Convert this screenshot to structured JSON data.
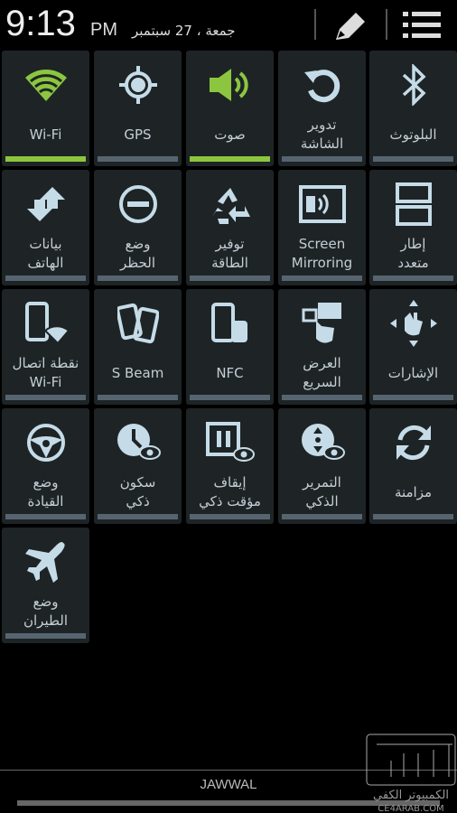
{
  "status": {
    "time": "9:13",
    "ampm": "PM",
    "date": "جمعة ، 27 سبتمبر",
    "edit_icon": "pencil-icon",
    "menu_icon": "list-icon"
  },
  "colors": {
    "active": "#8cc63f",
    "inactive": "#566470",
    "tile": "#1e2426",
    "icon": "#c5dce8"
  },
  "tiles": [
    {
      "label": "Wi-Fi",
      "icon": "wifi-icon",
      "active": true
    },
    {
      "label": "GPS",
      "icon": "gps-icon",
      "active": false
    },
    {
      "label": "صوت",
      "icon": "speaker-icon",
      "active": true
    },
    {
      "label": "تدوير\nالشاشة",
      "icon": "rotate-icon",
      "active": false
    },
    {
      "label": "البلوتوث",
      "icon": "bluetooth-icon",
      "active": false
    },
    {
      "label": "بيانات\nالهاتف",
      "icon": "data-arrows-icon",
      "active": false
    },
    {
      "label": "وضع\nالحظر",
      "icon": "block-icon",
      "active": false
    },
    {
      "label": "توفير\nالطاقة",
      "icon": "recycle-icon",
      "active": false
    },
    {
      "label": "Screen\nMirroring",
      "icon": "screen-mirroring-icon",
      "active": false
    },
    {
      "label": "إطار\nمتعدد",
      "icon": "multi-window-icon",
      "active": false
    },
    {
      "label": "نقطة اتصال\nWi-Fi",
      "icon": "hotspot-icon",
      "active": false
    },
    {
      "label": "S Beam",
      "icon": "s-beam-icon",
      "active": false
    },
    {
      "label": "NFC",
      "icon": "nfc-icon",
      "active": false
    },
    {
      "label": "العرض\nالسريع",
      "icon": "quick-glance-icon",
      "active": false
    },
    {
      "label": "الإشارات",
      "icon": "gesture-icon",
      "active": false
    },
    {
      "label": "وضع\nالقيادة",
      "icon": "steering-wheel-icon",
      "active": false
    },
    {
      "label": "سكون\nذكي",
      "icon": "smart-stay-icon",
      "active": false
    },
    {
      "label": "إيقاف\nمؤقت ذكي",
      "icon": "smart-pause-icon",
      "active": false
    },
    {
      "label": "التمرير\nالذكي",
      "icon": "smart-scroll-icon",
      "active": false
    },
    {
      "label": "مزامنة",
      "icon": "sync-icon",
      "active": false
    },
    {
      "label": "وضع\nالطيران",
      "icon": "airplane-icon",
      "active": false
    }
  ],
  "carrier": "JAWWAL",
  "watermark": "الكمبيوتر الكفي CE4ARAB.COM"
}
